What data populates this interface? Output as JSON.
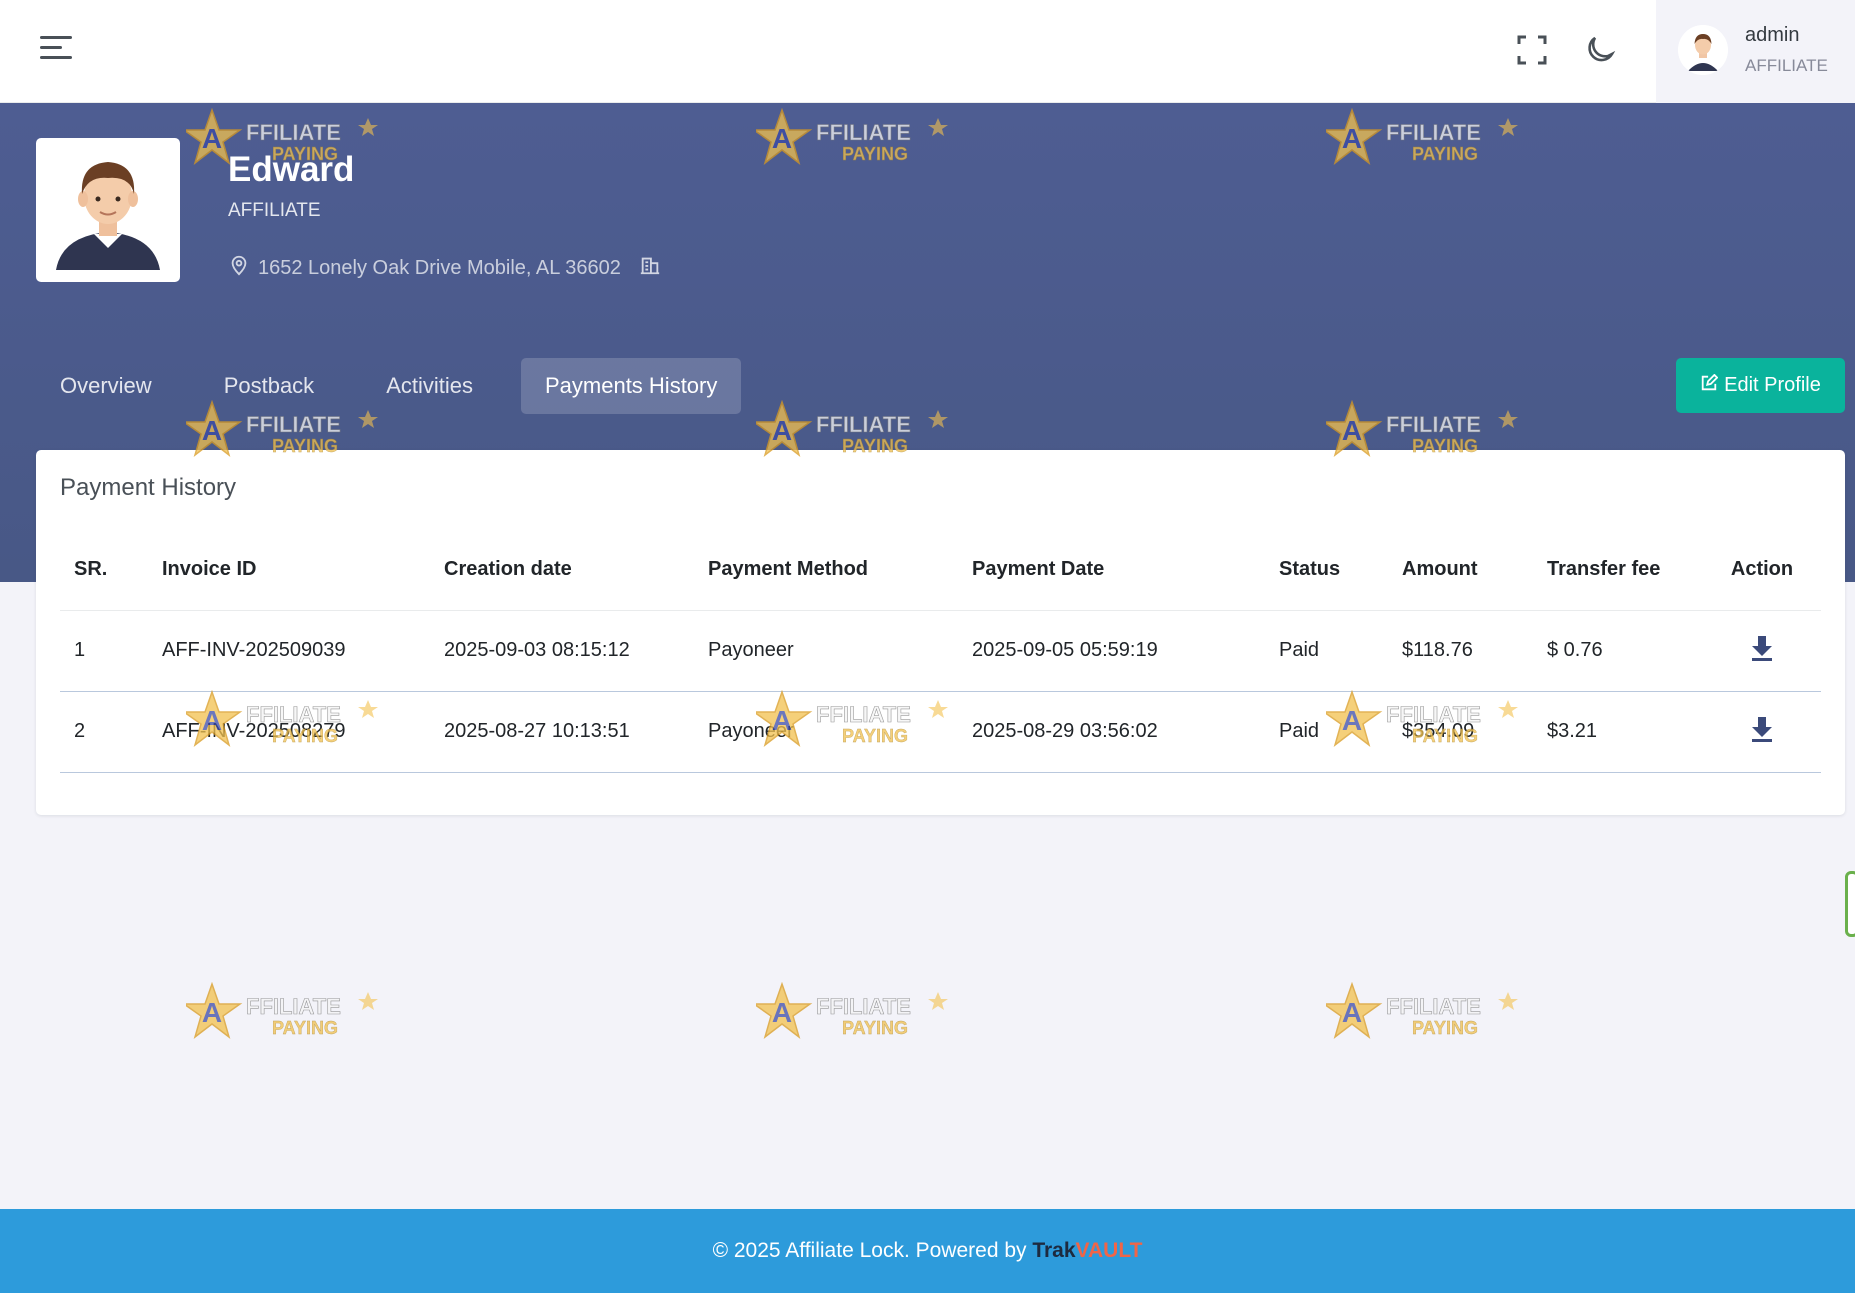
{
  "topbar": {
    "menu_icon": "hamburger-icon",
    "fullscreen_icon": "fullscreen-icon",
    "theme_icon": "moon-icon",
    "user": {
      "name": "admin",
      "role": "AFFILIATE"
    }
  },
  "profile": {
    "name": "Edward",
    "role": "AFFILIATE",
    "address": "1652 Lonely Oak Drive Mobile, AL 36602"
  },
  "tabs": [
    {
      "label": "Overview",
      "active": false
    },
    {
      "label": "Postback",
      "active": false
    },
    {
      "label": "Activities",
      "active": false
    },
    {
      "label": "Payments History",
      "active": true
    }
  ],
  "edit_profile_label": "Edit Profile",
  "payment_history": {
    "title": "Payment History",
    "columns": [
      "SR.",
      "Invoice ID",
      "Creation date",
      "Payment Method",
      "Payment Date",
      "Status",
      "Amount",
      "Transfer fee",
      "Action"
    ],
    "rows": [
      {
        "sr": "1",
        "invoice_id": "AFF-INV-202509039",
        "creation_date": "2025-09-03 08:15:12",
        "payment_method": "Payoneer",
        "payment_date": "2025-09-05 05:59:19",
        "status": "Paid",
        "amount": "$118.76",
        "transfer_fee": "$ 0.76",
        "action_icon": "download-icon"
      },
      {
        "sr": "2",
        "invoice_id": "AFF-INV-202508279",
        "creation_date": "2025-08-27 10:13:51",
        "payment_method": "Payoneer",
        "payment_date": "2025-08-29 03:56:02",
        "status": "Paid",
        "amount": "$354.09",
        "transfer_fee": "$3.21",
        "action_icon": "download-icon"
      }
    ]
  },
  "watermark": {
    "line1": "AFFILIATE",
    "line2": "PAYING"
  },
  "footer": {
    "text": "© 2025 Affiliate Lock. Powered by ",
    "brand_part1": "Trak",
    "brand_part2": "VAULT"
  },
  "colors": {
    "banner": "#4e5d92",
    "accent_green": "#0ab39c",
    "footer": "#2d9bdb",
    "brand_orange": "#f06548"
  }
}
